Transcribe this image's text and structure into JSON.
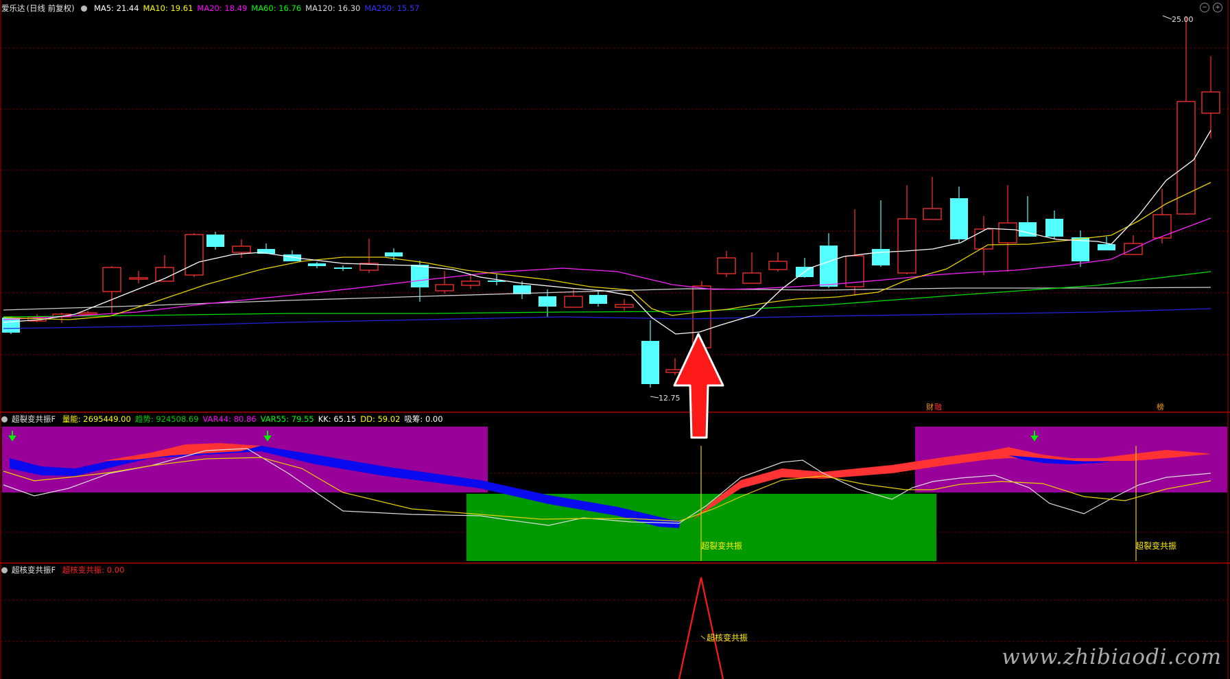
{
  "main_panel": {
    "stock_name": "爱乐达",
    "period": "(日线 前复权)",
    "indicators": [
      {
        "label": "MA5: 21.44",
        "color": "#ffffff"
      },
      {
        "label": "MA10: 19.61",
        "color": "#ffff00"
      },
      {
        "label": "MA20: 18.49",
        "color": "#ff00ff"
      },
      {
        "label": "MA60: 16.76",
        "color": "#00ff00"
      },
      {
        "label": "MA120: 16.30",
        "color": "#dddddd"
      },
      {
        "label": "MA250: 15.57",
        "color": "#3333ff"
      }
    ],
    "high_label": "25.00",
    "low_label": "12.75",
    "tags": [
      "财",
      "融",
      "榜"
    ]
  },
  "sub_panel_1": {
    "name": "超裂变共振F",
    "indicators": [
      {
        "label": "量能: 2695449.00",
        "color": "#ffff00"
      },
      {
        "label": "趋势: 924508.69",
        "color": "#00cc00"
      },
      {
        "label": "VAR44: 80.86",
        "color": "#ff00ff"
      },
      {
        "label": "VAR55: 79.55",
        "color": "#00ff00"
      },
      {
        "label": "KK: 65.15",
        "color": "#ffffff"
      },
      {
        "label": "DD: 59.02",
        "color": "#ffff00"
      },
      {
        "label": "吸筹: 0.00",
        "color": "#ffffff"
      }
    ],
    "signal_labels": [
      "超裂变共振",
      "超裂变共振"
    ]
  },
  "sub_panel_2": {
    "name": "超核变共振F",
    "indicators": [
      {
        "label": "超核变共振: 0.00",
        "color": "#ff2222"
      }
    ],
    "signal_label": "超核变共振"
  },
  "watermark": "www.zhibiaodi.com",
  "icons": [
    "toggle-icon",
    "up-arrow-icon",
    "down-arrow-icon"
  ]
}
